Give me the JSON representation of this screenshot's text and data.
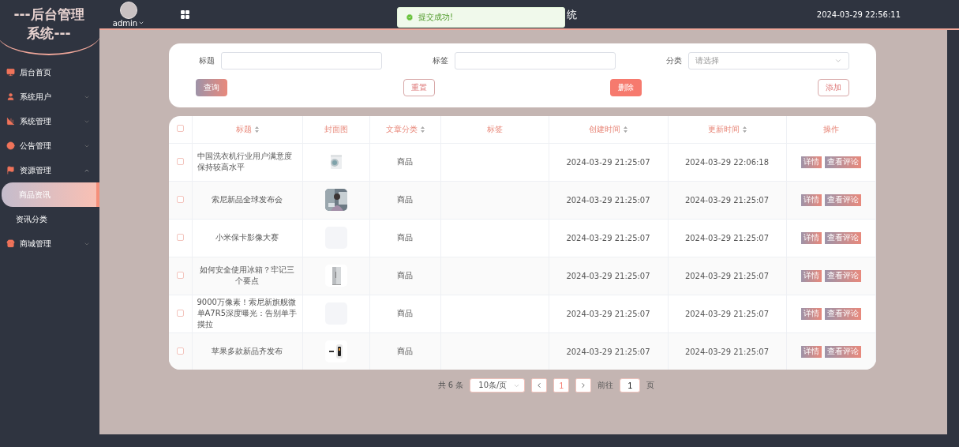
{
  "logo": {
    "title": "---后台管理系统---"
  },
  "header": {
    "user": "admin",
    "title": "统",
    "datetime": "2024-03-29 22:56:11"
  },
  "toast": {
    "message": "提交成功!"
  },
  "sidebar": {
    "items": [
      {
        "label": "后台首页",
        "selected": false
      },
      {
        "label": "系统用户",
        "selected": false,
        "expanded": false
      },
      {
        "label": "系统管理",
        "selected": false,
        "expanded": false
      },
      {
        "label": "公告管理",
        "selected": false,
        "expanded": false
      },
      {
        "label": "资源管理",
        "selected": false,
        "expanded": true,
        "children": [
          {
            "label": "商品资讯",
            "selected": true
          },
          {
            "label": "资讯分类",
            "selected": false
          }
        ]
      },
      {
        "label": "商城管理",
        "selected": false,
        "expanded": false
      }
    ]
  },
  "search": {
    "fields": [
      {
        "kind": "input",
        "label": "标题"
      },
      {
        "kind": "input",
        "label": "标签"
      },
      {
        "kind": "select",
        "label": "分类",
        "placeholder": "请选择"
      }
    ],
    "buttons": [
      {
        "label": "查询",
        "kind": "gradient"
      },
      {
        "label": "重置",
        "kind": "outline"
      },
      {
        "label": "删除",
        "kind": "danger"
      },
      {
        "label": "添加",
        "kind": "outline"
      }
    ]
  },
  "table": {
    "columns": [
      {
        "label": "标题",
        "sortable": true
      },
      {
        "label": "封面图",
        "sortable": false
      },
      {
        "label": "文章分类",
        "sortable": true
      },
      {
        "label": "标签",
        "sortable": false
      },
      {
        "label": "创建时间",
        "sortable": true
      },
      {
        "label": "更新时间",
        "sortable": true
      },
      {
        "label": "操作",
        "sortable": false
      }
    ],
    "header_checked": false,
    "rows": [
      {
        "checked": false,
        "title": "中国洗衣机行业用户满意度保持较高水平",
        "cover": {
          "kind": "picture"
        },
        "category": "商品",
        "created": "2024-03-29 21:25:07",
        "updated": "2024-03-29 22:06:18",
        "actions": [
          "详情",
          "查看评论"
        ]
      },
      {
        "checked": false,
        "title": "索尼新品全球发布会",
        "cover": {
          "kind": "picture"
        },
        "category": "商品",
        "created": "2024-03-29 21:25:07",
        "updated": "2024-03-29 21:25:07",
        "actions": [
          "详情",
          "查看评论"
        ]
      },
      {
        "checked": false,
        "title": "小米保卡影像大赛",
        "cover": {
          "kind": "empty"
        },
        "category": "商品",
        "created": "2024-03-29 21:25:07",
        "updated": "2024-03-29 21:25:07",
        "actions": [
          "详情",
          "查看评论"
        ]
      },
      {
        "checked": false,
        "title": "如何安全使用冰箱？牢记三个要点",
        "cover": {
          "kind": "picture"
        },
        "category": "商品",
        "created": "2024-03-29 21:25:07",
        "updated": "2024-03-29 21:25:07",
        "actions": [
          "详情",
          "查看评论"
        ]
      },
      {
        "checked": false,
        "title": "9000万像素！索尼新旗舰微单A7R5深度曝光：告别单手摸拉",
        "cover": {
          "kind": "empty"
        },
        "category": "商品",
        "created": "2024-03-29 21:25:07",
        "updated": "2024-03-29 21:25:07",
        "actions": [
          "详情",
          "查看评论"
        ]
      },
      {
        "checked": false,
        "title": "苹果多款新品齐发布",
        "cover": {
          "kind": "picture"
        },
        "category": "商品",
        "created": "2024-03-29 21:25:07",
        "updated": "2024-03-29 21:25:07",
        "actions": [
          "详情",
          "查看评论"
        ]
      }
    ]
  },
  "pagination": {
    "total": "共 6 条",
    "page_size": "10条/页",
    "pages": [
      {
        "label": "1",
        "selected": true
      }
    ],
    "goto_label": "前往",
    "goto_value": "1",
    "goto_suffix": "页"
  }
}
